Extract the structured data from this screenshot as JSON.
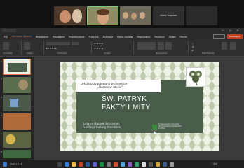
{
  "meeting": {
    "participant_name": "Anna Pawelec",
    "tile_labels": [
      "",
      "",
      "",
      "",
      ""
    ]
  },
  "ribbon_tabs": [
    "Plik",
    "Narzędzia główne",
    "Wstawianie",
    "Rysowanie",
    "Projektowanie",
    "Przejścia",
    "Animacje",
    "Pokaz slajdów",
    "Nagrywanie",
    "Recenzja",
    "Widok",
    "Pomoc"
  ],
  "active_tab_index": 1,
  "share_label": "Udostępnij",
  "ribbon_groups": [
    "Schowek",
    "Slajdy",
    "Czcionka",
    "Akapit",
    "Rysowanie",
    "Edytowanie"
  ],
  "slide": {
    "header_line1": "Lekcja przygotowana w projekcie",
    "header_line2": "„Narodz w szkole”",
    "title_line1": "ŚW. PATRYK",
    "title_line2": "FAKTY I MITY",
    "author_line1": "Justyna Maszek-Schramm,",
    "author_line2": "Fundacja Kultury Irlandzkiej",
    "logo_line1": "Fundacja Kultury Irlandzkiej",
    "logo_line2": "IRISH CULTURAL FOUNDATION",
    "logo_line3": "w Polsce"
  },
  "thumb_numbers": [
    "1",
    "2",
    "3",
    "4",
    "5",
    "6"
  ],
  "status": {
    "slide_counter": "Slajd 1 z 12"
  },
  "colors": {
    "accent": "#e6763e",
    "slide_green": "#4a5d4a",
    "pattern_green": "#b7c6a2"
  }
}
